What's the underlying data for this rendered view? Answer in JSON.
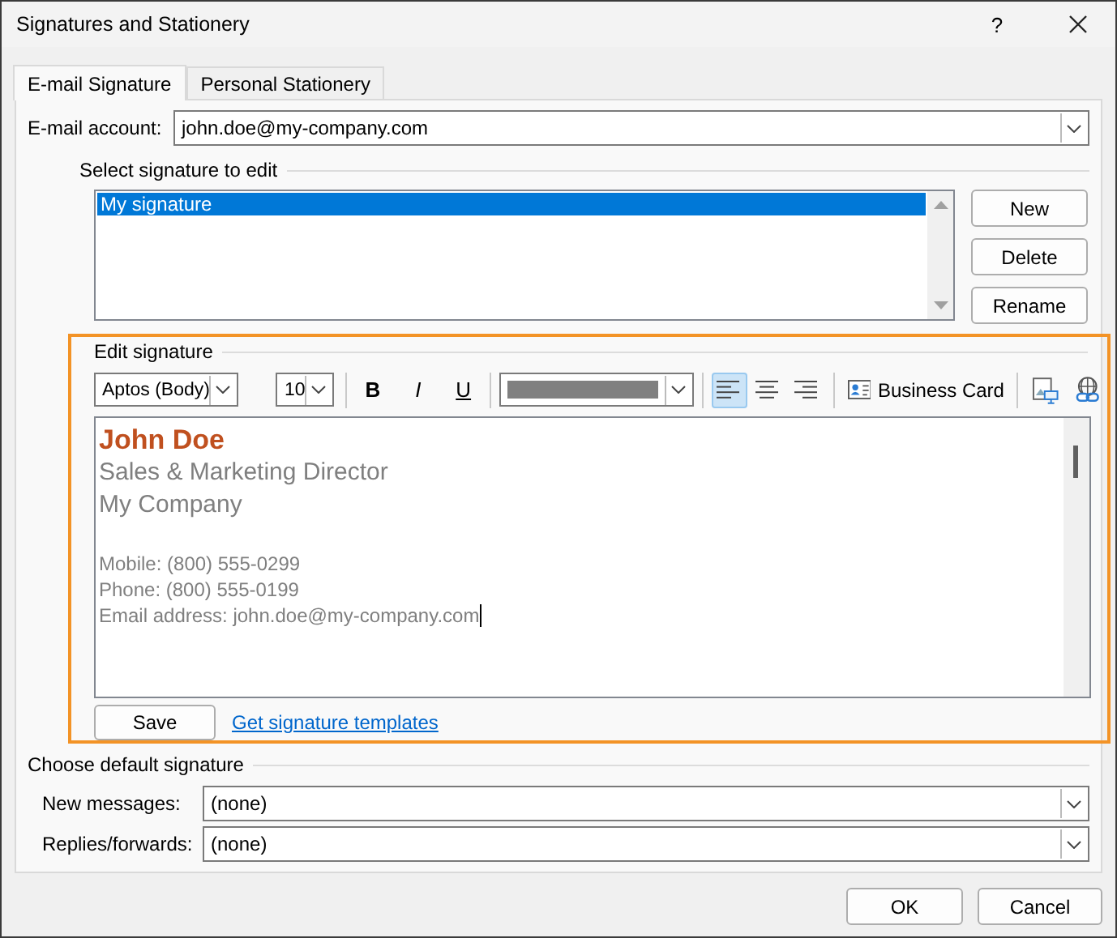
{
  "window": {
    "title": "Signatures and Stationery",
    "help": "?"
  },
  "tabs": [
    {
      "label": "E-mail Signature",
      "selected": true
    },
    {
      "label": "Personal Stationery",
      "selected": false
    }
  ],
  "email_account": {
    "label": "E-mail account:",
    "value": "john.doe@my-company.com"
  },
  "signature_list": {
    "label": "Select signature to edit",
    "items": [
      {
        "name": "My signature",
        "selected": true
      }
    ],
    "buttons": [
      "New",
      "Delete",
      "Rename"
    ]
  },
  "edit_signature": {
    "label": "Edit signature",
    "toolbar": {
      "font": "Aptos (Body)",
      "size": "10",
      "format_buttons": [
        {
          "kind": "bold",
          "label": "B"
        },
        {
          "kind": "italic",
          "label": "I"
        },
        {
          "kind": "underline",
          "label": "U"
        }
      ],
      "alignments": [
        {
          "kind": "left",
          "selected": true
        },
        {
          "kind": "center",
          "selected": false
        },
        {
          "kind": "right",
          "selected": false
        }
      ],
      "business_card": "Business Card"
    },
    "lines": [
      {
        "kind": "name",
        "text": "John Doe"
      },
      {
        "kind": "title",
        "text": "Sales & Marketing Director"
      },
      {
        "kind": "title",
        "text": "My Company"
      },
      {
        "kind": "contact",
        "text": "Mobile: (800) 555-0299"
      },
      {
        "kind": "contact",
        "text": "Phone: (800) 555-0199"
      },
      {
        "kind": "contact",
        "text": "Email address: john.doe@my-company.com"
      }
    ],
    "save": "Save",
    "templates_link": "Get signature templates"
  },
  "default_signature": {
    "label": "Choose default signature",
    "fields": [
      {
        "label": "New messages:",
        "value": "(none)"
      },
      {
        "label": "Replies/forwards:",
        "value": "(none)"
      }
    ]
  },
  "buttons": [
    "OK",
    "Cancel"
  ]
}
